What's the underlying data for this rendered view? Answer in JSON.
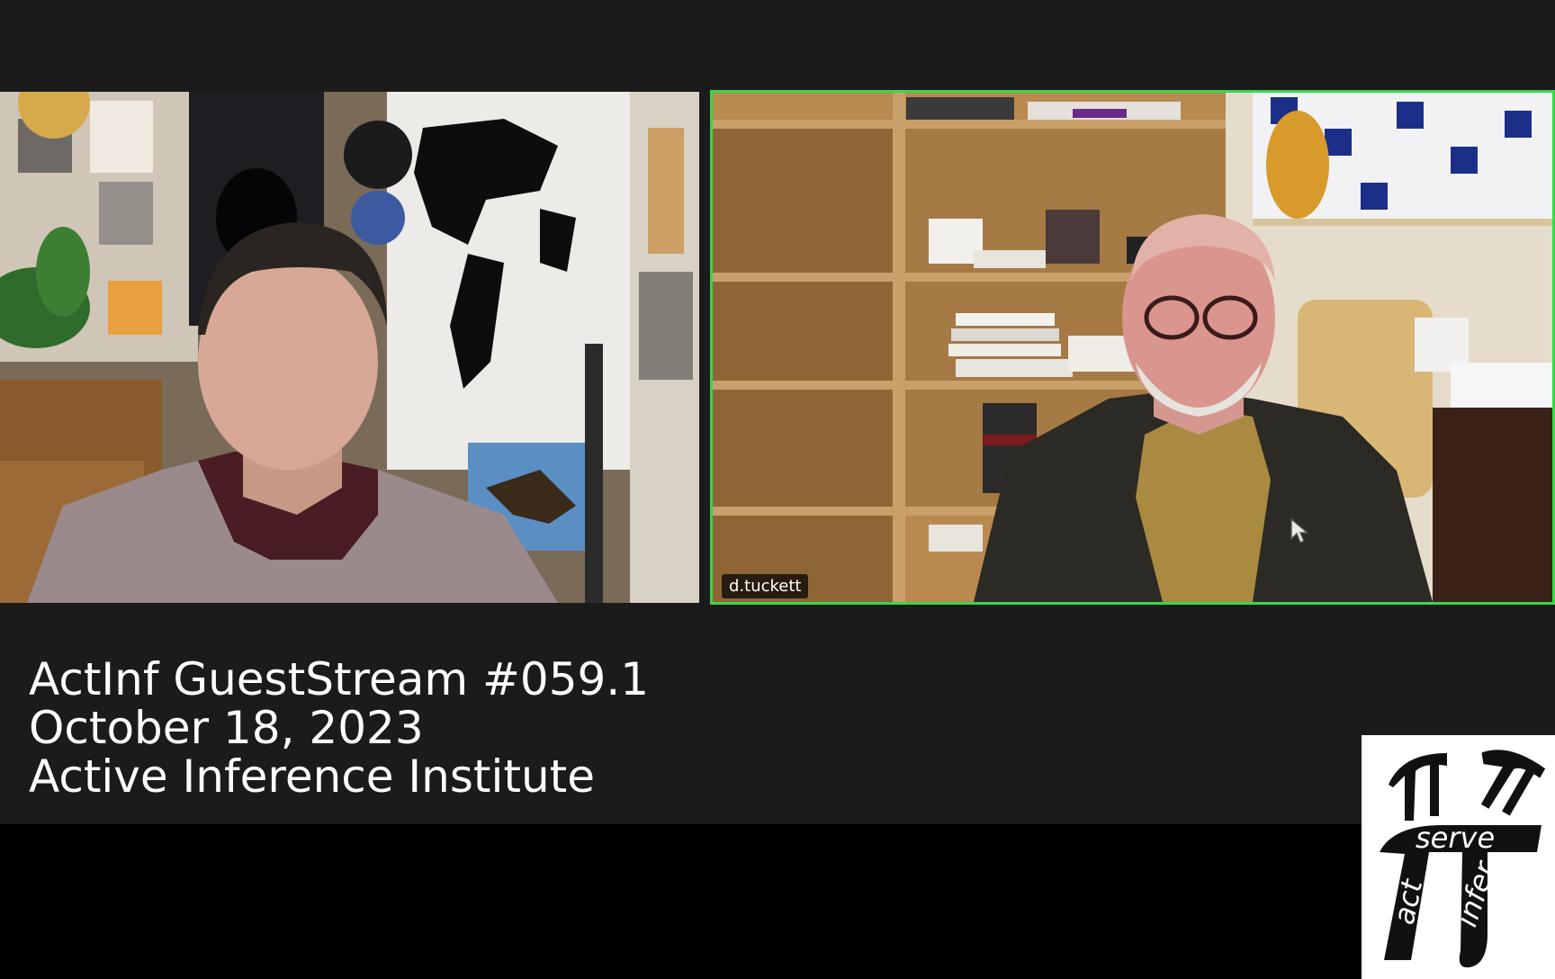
{
  "participants": [
    {
      "name": ""
    },
    {
      "name": "d.tuckett",
      "active_speaker": true
    }
  ],
  "caption": {
    "line1": "ActInf GuestStream #059.1",
    "line2": "October 18, 2023",
    "line3": "Active Inference Institute"
  },
  "logo": {
    "word_serve": "serve",
    "word_act": "act",
    "word_infer": "infer"
  },
  "colors": {
    "active_speaker_border": "#3ad64a",
    "background": "#1b1b1b"
  }
}
